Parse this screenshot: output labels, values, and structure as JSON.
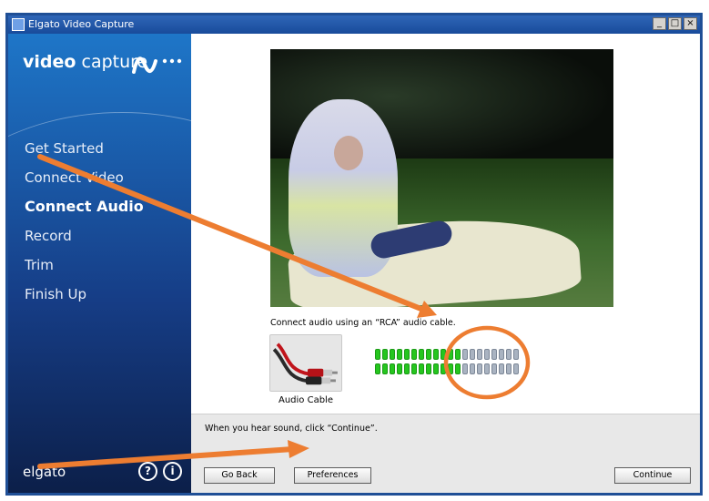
{
  "window": {
    "title": "Elgato Video Capture",
    "controls": {
      "minimize": "_",
      "maximize": "□",
      "close": "×"
    }
  },
  "sidebar": {
    "brand_bold": "video",
    "brand_light": "capture",
    "steps": [
      {
        "label": "Get Started",
        "active": false
      },
      {
        "label": "Connect Video",
        "active": false
      },
      {
        "label": "Connect Audio",
        "active": true
      },
      {
        "label": "Record",
        "active": false
      },
      {
        "label": "Trim",
        "active": false
      },
      {
        "label": "Finish Up",
        "active": false
      }
    ],
    "footer_brand": "elgato",
    "help_glyph": "?",
    "info_glyph": "i"
  },
  "main": {
    "caption": "Connect audio using an “RCA” audio cable.",
    "cable_label": "Audio Cable",
    "audio_meter": {
      "segments_per_row": 20,
      "lit_segments": [
        12,
        12
      ]
    },
    "hint": "When you hear sound, click “Continue”.",
    "buttons": {
      "back": "Go Back",
      "prefs": "Preferences",
      "continue": "Continue"
    }
  },
  "colors": {
    "title_bar": "#184b9b",
    "sidebar_top": "#1e76c8",
    "sidebar_bottom": "#0c1f49",
    "meter_on": "#25c61e",
    "meter_off": "#a9b3c1",
    "annotation": "#ed7d31"
  },
  "icons": [
    "app-icon",
    "brand-wave-icon",
    "help-icon",
    "info-icon",
    "rca-cable-icon"
  ]
}
